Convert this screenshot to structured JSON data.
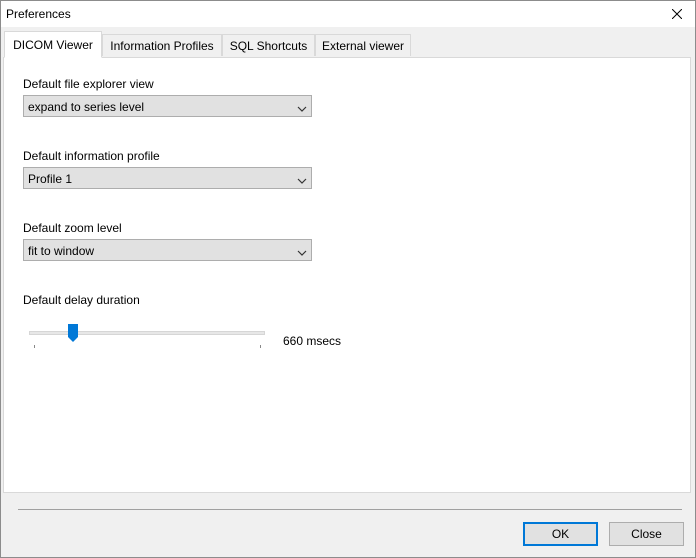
{
  "window": {
    "title": "Preferences"
  },
  "tabs": [
    {
      "label": "DICOM Viewer",
      "active": true
    },
    {
      "label": "Information Profiles",
      "active": false
    },
    {
      "label": "SQL Shortcuts",
      "active": false
    },
    {
      "label": "External viewer",
      "active": false
    }
  ],
  "fields": {
    "file_explorer_view": {
      "label": "Default file explorer view",
      "value": "expand to series level"
    },
    "information_profile": {
      "label": "Default information profile",
      "value": "Profile 1"
    },
    "zoom_level": {
      "label": "Default zoom level",
      "value": "fit to window"
    },
    "delay_duration": {
      "label": "Default delay duration",
      "value_text": "660 msecs",
      "slider_fraction": 0.16
    }
  },
  "buttons": {
    "ok": "OK",
    "close": "Close"
  },
  "colors": {
    "accent": "#0078d7",
    "button_bg": "#e1e1e1",
    "panel_bg": "#ffffff",
    "window_bg": "#f0f0f0"
  },
  "icons": {
    "close": "close-icon",
    "dropdown": "chevron-down-icon",
    "slider_thumb": "slider-thumb-icon"
  }
}
